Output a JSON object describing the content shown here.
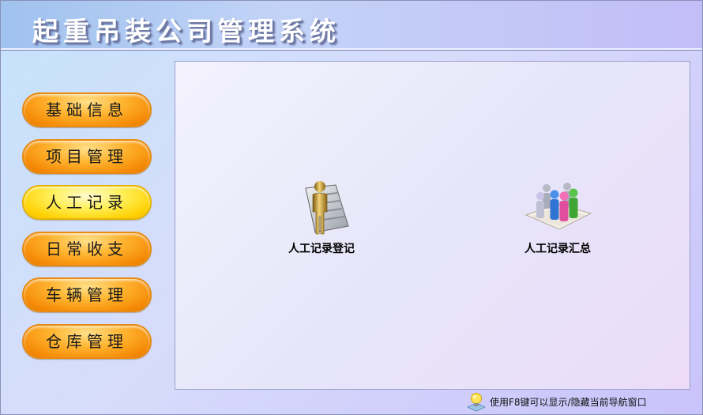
{
  "app": {
    "title": "起重吊装公司管理系统"
  },
  "sidebar": {
    "items": [
      {
        "label": "基础信息",
        "active": false
      },
      {
        "label": "项目管理",
        "active": false
      },
      {
        "label": "人工记录",
        "active": true
      },
      {
        "label": "日常收支",
        "active": false
      },
      {
        "label": "车辆管理",
        "active": false
      },
      {
        "label": "仓库管理",
        "active": false
      }
    ]
  },
  "main": {
    "functions": [
      {
        "label": "人工记录登记",
        "icon": "person-document-icon"
      },
      {
        "label": "人工记录汇总",
        "icon": "people-group-icon"
      }
    ]
  },
  "footer": {
    "hint": "使用F8键可以显示/隐藏当前导航窗口",
    "icon": "lightbulb-icon"
  },
  "colors": {
    "nav_button": "#ffb531",
    "nav_button_active": "#fff05a",
    "background": "#d7dcfb"
  }
}
